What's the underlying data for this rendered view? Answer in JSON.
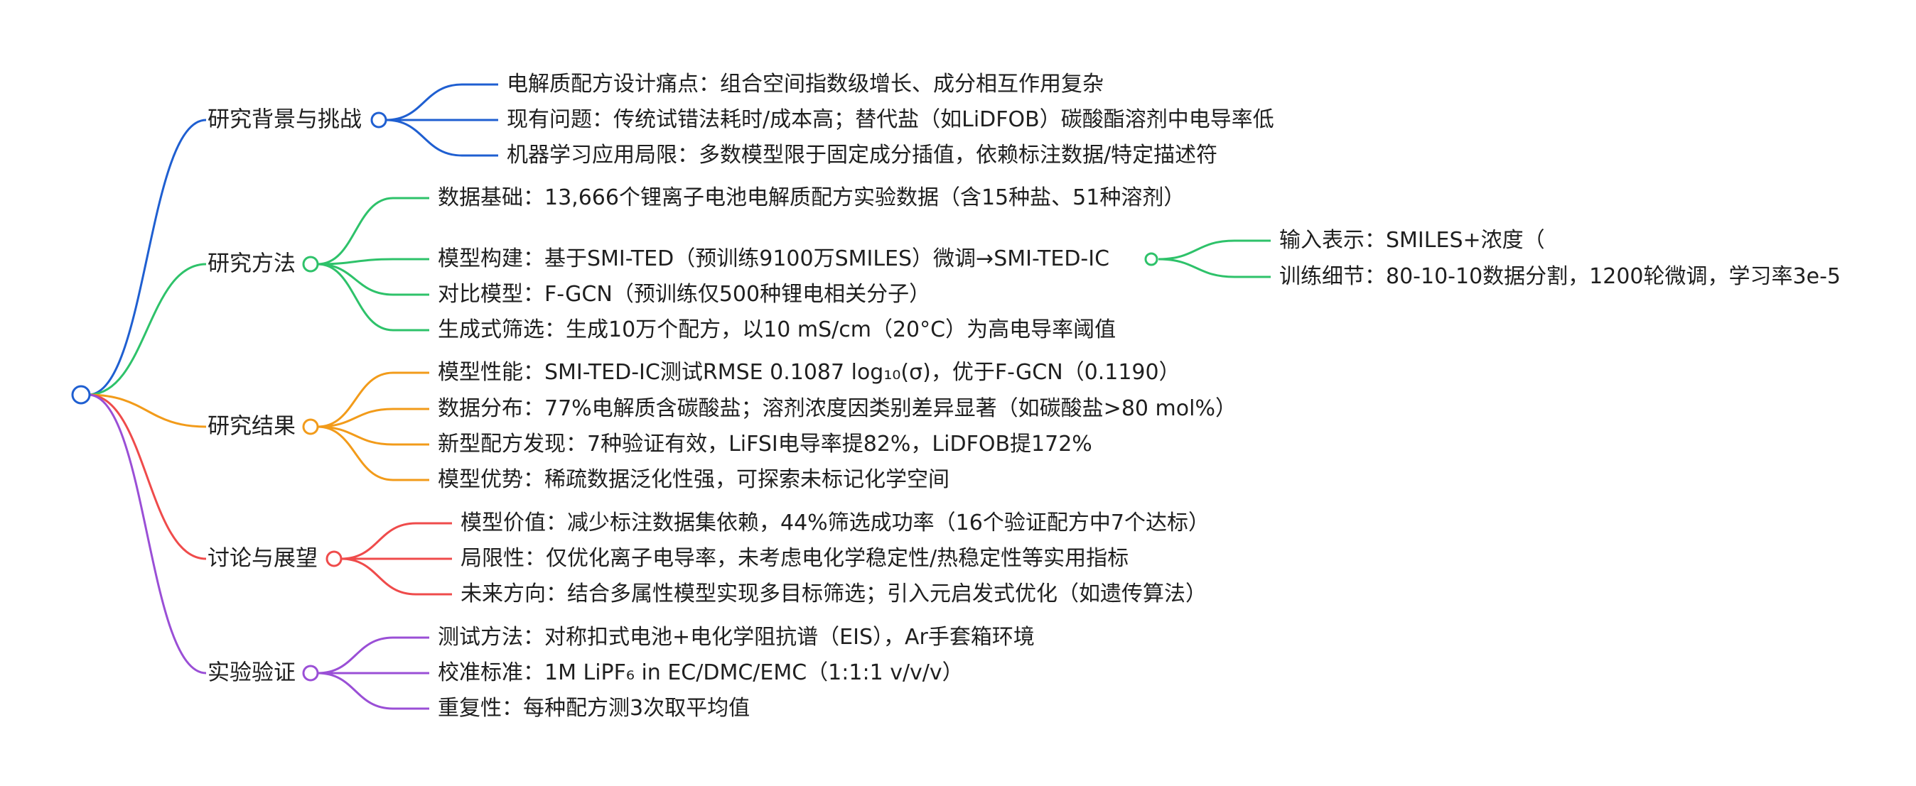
{
  "colors": {
    "background": "#ffffff",
    "text": "#1f1f1f",
    "branches": [
      "#1f5fd1",
      "#2ec26a",
      "#f29b1a",
      "#ef4b4b",
      "#9a4fd6"
    ]
  },
  "mindmap": {
    "root_label": "",
    "branches": [
      {
        "label": "研究背景与挑战",
        "color": "#1f5fd1",
        "children": [
          {
            "label": "电解质配方设计痛点：组合空间指数级增长、成分相互作用复杂"
          },
          {
            "label": "现有问题：传统试错法耗时/成本高；替代盐（如LiDFOB）碳酸酯溶剂中电导率低"
          },
          {
            "label": "机器学习应用局限：多数模型限于固定成分插值，依赖标注数据/特定描述符"
          }
        ]
      },
      {
        "label": "研究方法",
        "color": "#2ec26a",
        "children": [
          {
            "label": "数据基础：13,666个锂离子电池电解质配方实验数据（含15种盐、51种溶剂）"
          },
          {
            "label": "模型构建：基于SMI-TED（预训练9100万SMILES）微调→SMI-TED-IC",
            "children": [
              {
                "label": "输入表示：SMILES+浓度（"
              },
              {
                "label": "训练细节：80-10-10数据分割，1200轮微调，学习率3e-5"
              }
            ]
          },
          {
            "label": "对比模型：F-GCN（预训练仅500种锂电相关分子）"
          },
          {
            "label": "生成式筛选：生成10万个配方，以10 mS/cm（20°C）为高电导率阈值"
          }
        ]
      },
      {
        "label": "研究结果",
        "color": "#f29b1a",
        "children": [
          {
            "label": "模型性能：SMI-TED-IC测试RMSE 0.1087 log₁₀(σ)，优于F-GCN（0.1190）"
          },
          {
            "label": "数据分布：77%电解质含碳酸盐；溶剂浓度因类别差异显著（如碳酸盐>80 mol%）"
          },
          {
            "label": "新型配方发现：7种验证有效，LiFSI电导率提82%，LiDFOB提172%"
          },
          {
            "label": "模型优势：稀疏数据泛化性强，可探索未标记化学空间"
          }
        ]
      },
      {
        "label": "讨论与展望",
        "color": "#ef4b4b",
        "children": [
          {
            "label": "模型价值：减少标注数据集依赖，44%筛选成功率（16个验证配方中7个达标）"
          },
          {
            "label": "局限性：仅优化离子电导率，未考虑电化学稳定性/热稳定性等实用指标"
          },
          {
            "label": "未来方向：结合多属性模型实现多目标筛选；引入元启发式优化（如遗传算法）"
          }
        ]
      },
      {
        "label": "实验验证",
        "color": "#9a4fd6",
        "children": [
          {
            "label": "测试方法：对称扣式电池+电化学阻抗谱（EIS），Ar手套箱环境"
          },
          {
            "label": "校准标准：1M LiPF₆ in EC/DMC/EMC（1:1:1 v/v/v）"
          },
          {
            "label": "重复性：每种配方测3次取平均值"
          }
        ]
      }
    ]
  }
}
